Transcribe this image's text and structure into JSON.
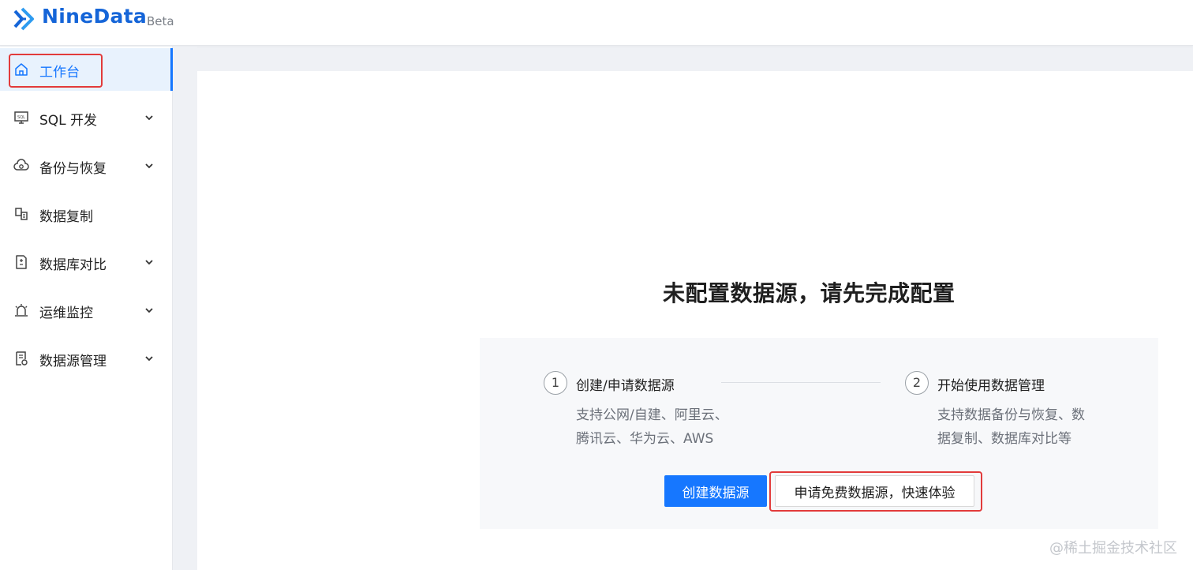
{
  "brand": {
    "name": "NineData",
    "badge": "Beta",
    "color": "#1565d8"
  },
  "sidebar": {
    "items": [
      {
        "label": "工作台",
        "icon": "home-icon",
        "active": true,
        "expandable": false
      },
      {
        "label": "SQL 开发",
        "icon": "sql-monitor-icon",
        "active": false,
        "expandable": true
      },
      {
        "label": "备份与恢复",
        "icon": "cloud-backup-icon",
        "active": false,
        "expandable": true
      },
      {
        "label": "数据复制",
        "icon": "data-copy-icon",
        "active": false,
        "expandable": false
      },
      {
        "label": "数据库对比",
        "icon": "compare-doc-icon",
        "active": false,
        "expandable": true
      },
      {
        "label": "运维监控",
        "icon": "alarm-icon",
        "active": false,
        "expandable": true
      },
      {
        "label": "数据源管理",
        "icon": "datasource-icon",
        "active": false,
        "expandable": true
      }
    ]
  },
  "main": {
    "empty_title": "未配置数据源，请先完成配置",
    "steps": [
      {
        "number": "1",
        "title": "创建/申请数据源",
        "desc_lines": [
          "支持公网/自建、阿里云、",
          "腾讯云、华为云、AWS"
        ]
      },
      {
        "number": "2",
        "title": "开始使用数据管理",
        "desc_lines": [
          "支持数据备份与恢复、数",
          "据复制、数据库对比等"
        ]
      }
    ],
    "primary_button": "创建数据源",
    "secondary_button": "申请免费数据源，快速体验"
  },
  "watermark": "@稀土掘金技术社区",
  "colors": {
    "accent": "#1677ff",
    "annotation": "#e23b3b"
  }
}
